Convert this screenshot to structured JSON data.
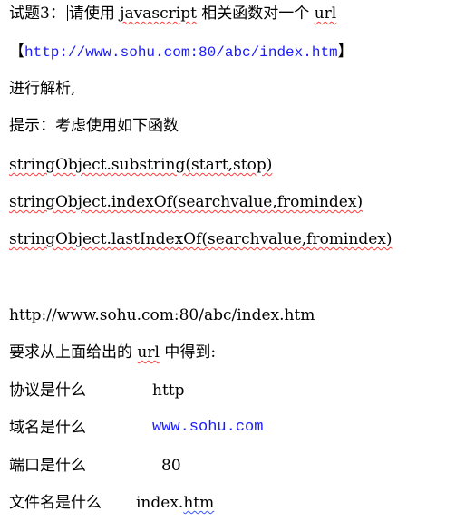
{
  "question": {
    "prefix": "试题3：",
    "lead": "请使用 ",
    "js": "javascript",
    "mid": " 相关函数对一个 ",
    "url_word": "url"
  },
  "url_line": {
    "open": "【",
    "url": "http://www.sohu.com:80/abc/index.htm",
    "close": "】"
  },
  "parse_line": "进行解析,",
  "hint_line": "提示：考虑使用如下函数",
  "functions": [
    {
      "name": "stringObject.substring",
      "args": "(start,stop)"
    },
    {
      "name": "stringObject.indexOf",
      "args": "(searchvalue,fromindex)"
    },
    {
      "name": "stringObject.lastIndexOf",
      "args": "(searchvalue,fromindex)"
    }
  ],
  "url_plain": "http://www.sohu.com:80/abc/index.htm",
  "require": {
    "lead": "要求从上面给出的  ",
    "url_word": "url",
    "tail": " 中得到:"
  },
  "answers": [
    {
      "label": "协议是什么",
      "value": "http"
    },
    {
      "label": "域名是什么",
      "value": "www.sohu.com"
    },
    {
      "label": "端口是什么",
      "value": "80"
    },
    {
      "label": "文件名是什么",
      "value": "index.htm"
    }
  ],
  "colors": {
    "link_blue": "#1a1aff",
    "spell_red": "#ff3b3b",
    "text": "#000000"
  }
}
